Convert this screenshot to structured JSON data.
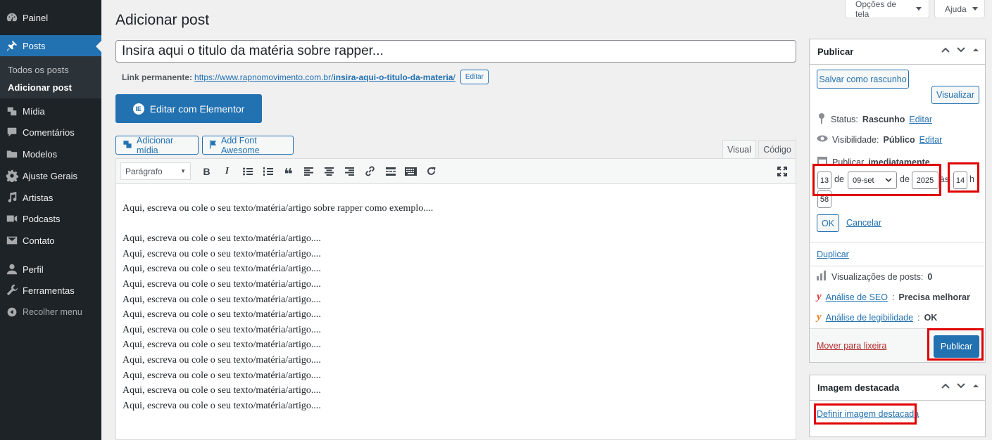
{
  "sidebar": {
    "items": [
      {
        "label": "Painel"
      },
      {
        "label": "Posts"
      },
      {
        "label": "Mídia"
      },
      {
        "label": "Comentários"
      },
      {
        "label": "Modelos"
      },
      {
        "label": "Ajuste Gerais"
      },
      {
        "label": "Artistas"
      },
      {
        "label": "Podcasts"
      },
      {
        "label": "Contato"
      },
      {
        "label": "Perfil"
      },
      {
        "label": "Ferramentas"
      }
    ],
    "submenu": [
      "Todos os posts",
      "Adicionar post"
    ],
    "collapse": "Recolher menu"
  },
  "screen_meta": {
    "options": "Opções de tela",
    "help": "Ajuda"
  },
  "page": {
    "title": "Adicionar post"
  },
  "post": {
    "title_value": "Insira aqui o titulo da matéria sobre rapper...",
    "permalink_label": "Link permanente:",
    "permalink_base": "https://www.rapnomovimento.com.br/",
    "permalink_slug": "insira-aqui-o-titulo-da-materia",
    "permalink_slash": "/",
    "edit_slug": "Editar"
  },
  "elementor": {
    "label": "Editar com Elementor"
  },
  "media": {
    "add_media": "Adicionar mídia",
    "font_awesome": "Add Font Awesome"
  },
  "editor": {
    "tabs": [
      "Visual",
      "Código"
    ],
    "format": "Parágrafo",
    "lines": [
      "Aqui, escreva ou cole o seu texto/matéria/artigo sobre rapper como exemplo....",
      "",
      "Aqui, escreva ou cole o seu texto/matéria/artigo....",
      "Aqui, escreva ou cole o seu texto/matéria/artigo....",
      "Aqui, escreva ou cole o seu texto/matéria/artigo....",
      "Aqui, escreva ou cole o seu texto/matéria/artigo....",
      "Aqui, escreva ou cole o seu texto/matéria/artigo....",
      "Aqui, escreva ou cole o seu texto/matéria/artigo....",
      "Aqui, escreva ou cole o seu texto/matéria/artigo....",
      "Aqui, escreva ou cole o seu texto/matéria/artigo....",
      "Aqui, escreva ou cole o seu texto/matéria/artigo....",
      "Aqui, escreva ou cole o seu texto/matéria/artigo....",
      "Aqui, escreva ou cole o seu texto/matéria/artigo....",
      "Aqui, escreva ou cole o seu texto/matéria/artigo...."
    ]
  },
  "publish": {
    "title": "Publicar",
    "save_draft": "Salvar como rascunho",
    "preview": "Visualizar",
    "status_label": "Status:",
    "status_value": "Rascunho",
    "edit": "Editar",
    "visibility_label": "Visibilidade:",
    "visibility_value": "Público",
    "schedule_label": "Publicar",
    "schedule_value": "imediatamente",
    "day": "13",
    "de1": "de",
    "month": "09-set",
    "de2": "de",
    "year": "2025",
    "at": "às",
    "hour": "14",
    "h": "h",
    "minute": "58",
    "ok": "OK",
    "cancel": "Cancelar",
    "duplicate": "Duplicar",
    "views_label": "Visualizações de posts:",
    "views_value": "0",
    "seo_link": "Análise de SEO",
    "seo_value": "Precisa melhorar",
    "read_link": "Análise de legibilidade",
    "read_value": "OK",
    "trash": "Mover para lixeira",
    "publish_btn": "Publicar"
  },
  "featured": {
    "title": "Imagem destacada",
    "set": "Definir imagem destacada"
  },
  "colors": {
    "accent": "#2271b1",
    "sidebar": "#1d2327",
    "highlight": "#e00000"
  }
}
